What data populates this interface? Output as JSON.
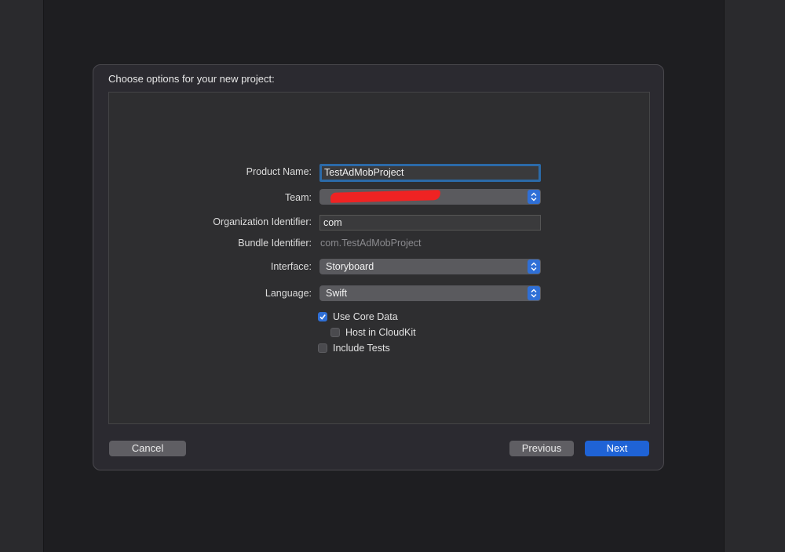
{
  "dialog": {
    "title": "Choose options for your new project:",
    "fields": {
      "product_name": {
        "label": "Product Name:",
        "value": "TestAdMobProject"
      },
      "team": {
        "label": "Team:",
        "value": ""
      },
      "organization_identifier": {
        "label": "Organization Identifier:",
        "value": "com"
      },
      "bundle_identifier": {
        "label": "Bundle Identifier:",
        "value": "com.TestAdMobProject"
      },
      "interface": {
        "label": "Interface:",
        "value": "Storyboard"
      },
      "language": {
        "label": "Language:",
        "value": "Swift"
      }
    },
    "checkboxes": {
      "use_core_data": {
        "label": "Use Core Data",
        "checked": true
      },
      "host_in_cloudkit": {
        "label": "Host in CloudKit",
        "checked": false
      },
      "include_tests": {
        "label": "Include Tests",
        "checked": false
      }
    },
    "buttons": {
      "cancel": "Cancel",
      "previous": "Previous",
      "next": "Next"
    }
  },
  "colors": {
    "accent": "#2f6fd6",
    "redaction": "#ef2323",
    "background": "#1e1e21"
  }
}
